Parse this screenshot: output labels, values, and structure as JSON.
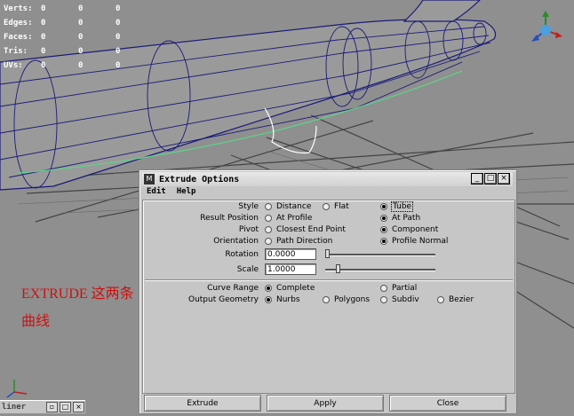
{
  "viewport": {
    "hud": [
      {
        "label": "Verts:",
        "values": [
          "0",
          "0",
          "0"
        ]
      },
      {
        "label": "Edges:",
        "values": [
          "0",
          "0",
          "0"
        ]
      },
      {
        "label": "Faces:",
        "values": [
          "0",
          "0",
          "0"
        ]
      },
      {
        "label": "Tris:",
        "values": [
          "0",
          "0",
          "0"
        ]
      },
      {
        "label": "UVs:",
        "values": [
          "0",
          "0",
          "0"
        ]
      }
    ],
    "annotation": {
      "line1": "EXTRUDE 这两条",
      "line2": "曲线"
    },
    "wire_color": "#1a1a7a",
    "curve_color": "#5fd08a",
    "annotation_color": "#cc1010"
  },
  "outliner": {
    "title": "liner"
  },
  "dialog": {
    "title": "Extrude Options",
    "menu": [
      "Edit",
      "Help"
    ],
    "style": {
      "label": "Style",
      "options": [
        "Distance",
        "Flat",
        "Tube"
      ],
      "selected": "Tube"
    },
    "result_position": {
      "label": "Result Position",
      "options": [
        "At Profile",
        "At Path"
      ],
      "selected": "At Path"
    },
    "pivot": {
      "label": "Pivot",
      "options": [
        "Closest End Point",
        "Component"
      ],
      "selected": "Component"
    },
    "orientation": {
      "label": "Orientation",
      "options": [
        "Path Direction",
        "Profile Normal"
      ],
      "selected": "Profile Normal"
    },
    "rotation": {
      "label": "Rotation",
      "value": "0.0000",
      "slider": 0.0
    },
    "scale": {
      "label": "Scale",
      "value": "1.0000",
      "slider": 0.1
    },
    "curve_range": {
      "label": "Curve Range",
      "options": [
        "Complete",
        "Partial"
      ],
      "selected": "Complete"
    },
    "output_geometry": {
      "label": "Output Geometry",
      "options": [
        "Nurbs",
        "Polygons",
        "Subdiv",
        "Bezier"
      ],
      "selected": "Nurbs"
    },
    "buttons": {
      "extrude": "Extrude",
      "apply": "Apply",
      "close": "Close"
    }
  }
}
